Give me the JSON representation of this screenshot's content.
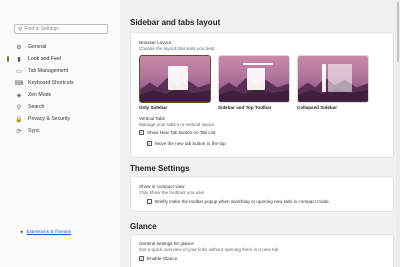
{
  "sidebar": {
    "search_placeholder": "Find in Settings",
    "items": [
      {
        "label": "General",
        "icon": "gear-icon",
        "glyph": "⚙"
      },
      {
        "label": "Look and Feel",
        "icon": "brush-icon",
        "glyph": "▮"
      },
      {
        "label": "Tab Management",
        "icon": "tab-icon",
        "glyph": "▭"
      },
      {
        "label": "Keyboard Shortcuts",
        "icon": "keyboard-icon",
        "glyph": "⌨"
      },
      {
        "label": "Zen Mods",
        "icon": "puzzle-icon",
        "glyph": "◈"
      },
      {
        "label": "Search",
        "icon": "search-icon",
        "glyph": "⚲"
      },
      {
        "label": "Privacy & Security",
        "icon": "lock-icon",
        "glyph": "🔒"
      },
      {
        "label": "Sync",
        "icon": "sync-icon",
        "glyph": "⟳"
      }
    ],
    "footer_link": "Extensions & Themes"
  },
  "layout_section": {
    "title": "Sidebar and tabs layout",
    "subtitle": "Browser Layout",
    "description": "Choose the layout that suits you best",
    "options": [
      {
        "label": "Only Sidebar",
        "selected": true
      },
      {
        "label": "Sidebar and Top Toolbar",
        "selected": false
      },
      {
        "label": "Collapsed Sidebar",
        "selected": false
      }
    ],
    "vertical_tabs_title": "Vertical Tabs",
    "vertical_tabs_desc": "Manage your tabs in a vertical layout",
    "show_new_tab_label": "Show New Tab Button on Tab List",
    "move_new_tab_label": "Move the new tab button to the top"
  },
  "theme_section": {
    "title": "Theme Settings",
    "compact_title": "Show in compact view",
    "compact_desc": "Only show the toolbars you use!",
    "popup_label": "Briefly make the toolbar popup when switching or opening new tabs in compact mode"
  },
  "glance_section": {
    "title": "Glance",
    "subtitle": "General settings for glance",
    "description": "Get a quick overview of your links without opening them in a new tab",
    "enable_label": "Enable Glance"
  },
  "colors": {
    "accent": "#8a6d3b",
    "link": "#1a56c7",
    "background": "#f1f1f1",
    "card": "#ffffff"
  }
}
